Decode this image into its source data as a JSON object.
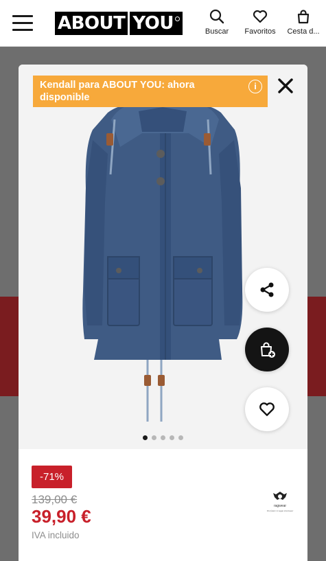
{
  "header": {
    "logo_part1": "ABOUT",
    "logo_part2": "YOU",
    "search_label": "Buscar",
    "favorites_label": "Favoritos",
    "cart_label": "Cesta d..."
  },
  "banner": {
    "text": "Kendall para ABOUT YOU: ahora disponible",
    "info_icon": "i",
    "background": "#f7a93b"
  },
  "gallery": {
    "image": "navy hooded parka jacket",
    "dots": 5,
    "active_dot": 0
  },
  "actions": {
    "share_icon": "share-icon",
    "bag_icon": "add-to-bag-icon",
    "heart_icon": "heart-icon"
  },
  "pricing": {
    "discount": "-71%",
    "old_price": "139,00 €",
    "price": "39,90 €",
    "vat": "IVA incluido",
    "accent": "#c8202a"
  },
  "brand": {
    "logo_text": "ragwear",
    "tagline": "The future is vegan streetwear"
  }
}
